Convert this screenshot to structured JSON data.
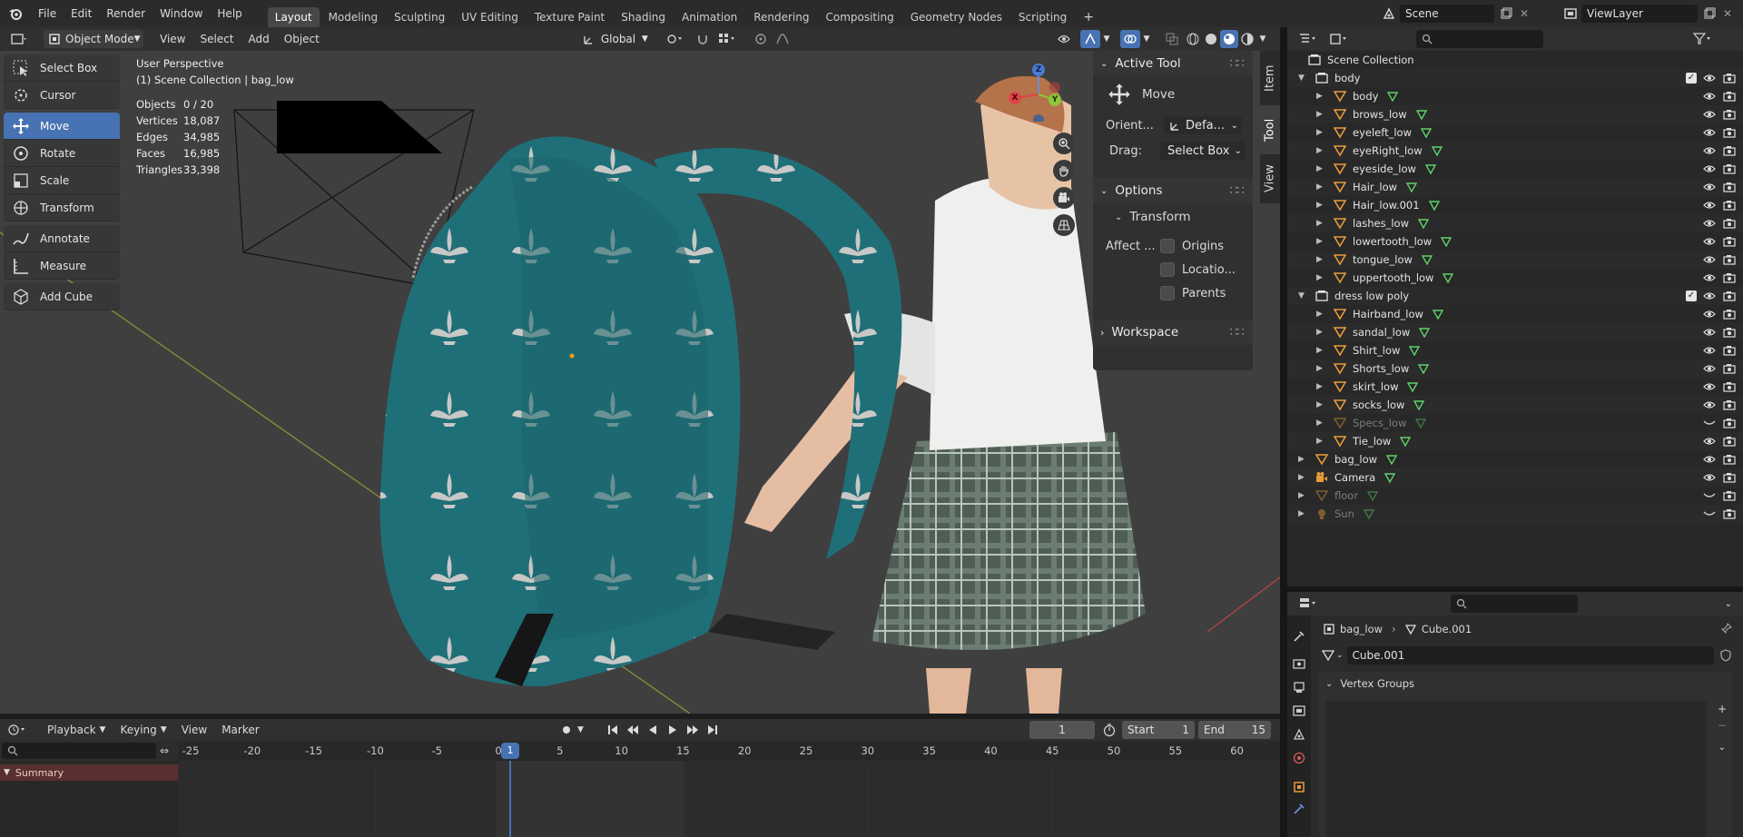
{
  "topbar": {
    "menu": [
      "File",
      "Edit",
      "Render",
      "Window",
      "Help"
    ],
    "workspaces": [
      "Layout",
      "Modeling",
      "Sculpting",
      "UV Editing",
      "Texture Paint",
      "Shading",
      "Animation",
      "Rendering",
      "Compositing",
      "Geometry Nodes",
      "Scripting"
    ],
    "active_workspace": "Layout",
    "add_tab": "+",
    "scene_name": "Scene",
    "view_layer": "ViewLayer"
  },
  "viewport_header": {
    "mode": "Object Mode",
    "menus": [
      "View",
      "Select",
      "Add",
      "Object"
    ],
    "orientation": "Global"
  },
  "toolbar": {
    "tools": [
      "Select Box",
      "Cursor",
      "Move",
      "Rotate",
      "Scale",
      "Transform",
      "Annotate",
      "Measure",
      "Add Cube"
    ],
    "active": "Move"
  },
  "overlay": {
    "perspective": "User Perspective",
    "collection": "(1) Scene Collection | bag_low",
    "stats": [
      {
        "key": "Objects",
        "value": "0 / 20"
      },
      {
        "key": "Vertices",
        "value": "18,087"
      },
      {
        "key": "Edges",
        "value": "34,985"
      },
      {
        "key": "Faces",
        "value": "16,985"
      },
      {
        "key": "Triangles",
        "value": "33,398"
      }
    ]
  },
  "gizmo": {
    "x": "X",
    "y": "Y",
    "z": "Z"
  },
  "npanel": {
    "tabs": [
      "Item",
      "Tool",
      "View"
    ],
    "active_tab": "Tool",
    "active_tool_title": "Active Tool",
    "tool_name": "Move",
    "orient_label": "Orient...",
    "orient_value": "Defa...",
    "drag_label": "Drag:",
    "drag_value": "Select Box",
    "options_title": "Options",
    "transform_title": "Transform",
    "affect_label": "Affect ...",
    "affect_options": [
      "Origins",
      "Locatio...",
      "Parents"
    ],
    "workspace_title": "Workspace"
  },
  "outliner": {
    "root": "Scene Collection",
    "rows": [
      {
        "label": "body",
        "type": "collection",
        "indent": 1,
        "checked": true
      },
      {
        "label": "body",
        "type": "mesh",
        "indent": 2
      },
      {
        "label": "brows_low",
        "type": "mesh",
        "indent": 2
      },
      {
        "label": "eyeleft_low",
        "type": "mesh",
        "indent": 2
      },
      {
        "label": "eyeRight_low",
        "type": "mesh",
        "indent": 2
      },
      {
        "label": "eyeside_low",
        "type": "mesh",
        "indent": 2
      },
      {
        "label": "Hair_low",
        "type": "mesh",
        "indent": 2
      },
      {
        "label": "Hair_low.001",
        "type": "mesh",
        "indent": 2
      },
      {
        "label": "lashes_low",
        "type": "mesh",
        "indent": 2
      },
      {
        "label": "lowertooth_low",
        "type": "mesh",
        "indent": 2
      },
      {
        "label": "tongue_low",
        "type": "mesh",
        "indent": 2
      },
      {
        "label": "uppertooth_low",
        "type": "mesh",
        "indent": 2
      },
      {
        "label": "dress low poly",
        "type": "collection",
        "indent": 1,
        "checked": true
      },
      {
        "label": "Hairband_low",
        "type": "mesh",
        "indent": 2
      },
      {
        "label": "sandal_low",
        "type": "mesh",
        "indent": 2
      },
      {
        "label": "Shirt_low",
        "type": "mesh",
        "indent": 2
      },
      {
        "label": "Shorts_low",
        "type": "mesh",
        "indent": 2
      },
      {
        "label": "skirt_low",
        "type": "mesh",
        "indent": 2
      },
      {
        "label": "socks_low",
        "type": "mesh",
        "indent": 2
      },
      {
        "label": "Specs_low",
        "type": "mesh",
        "indent": 2,
        "hidden": true
      },
      {
        "label": "Tie_low",
        "type": "mesh",
        "indent": 2
      },
      {
        "label": "bag_low",
        "type": "mesh",
        "indent": 1
      },
      {
        "label": "Camera",
        "type": "camera",
        "indent": 1
      },
      {
        "label": "floor",
        "type": "mesh",
        "indent": 1,
        "hidden": true
      },
      {
        "label": "Sun",
        "type": "light",
        "indent": 1,
        "hidden": true
      }
    ]
  },
  "properties": {
    "breadcrumb_object": "bag_low",
    "breadcrumb_mesh": "Cube.001",
    "mesh_name": "Cube.001",
    "section": "Vertex Groups"
  },
  "timeline": {
    "menus": [
      "Playback",
      "Keying",
      "View",
      "Marker"
    ],
    "current_frame": "1",
    "start_label": "Start",
    "start": "1",
    "end_label": "End",
    "end": "15",
    "ticks": [
      "-25",
      "-20",
      "-15",
      "-10",
      "-5",
      "0",
      "5",
      "10",
      "15",
      "20",
      "25",
      "30",
      "35",
      "40",
      "45",
      "50",
      "55",
      "60"
    ],
    "summary": "Summary"
  },
  "colors": {
    "accent": "#4772b3",
    "mesh": "#e89b3a",
    "collection": "#e6e6e6",
    "data": "#5fd16a"
  }
}
